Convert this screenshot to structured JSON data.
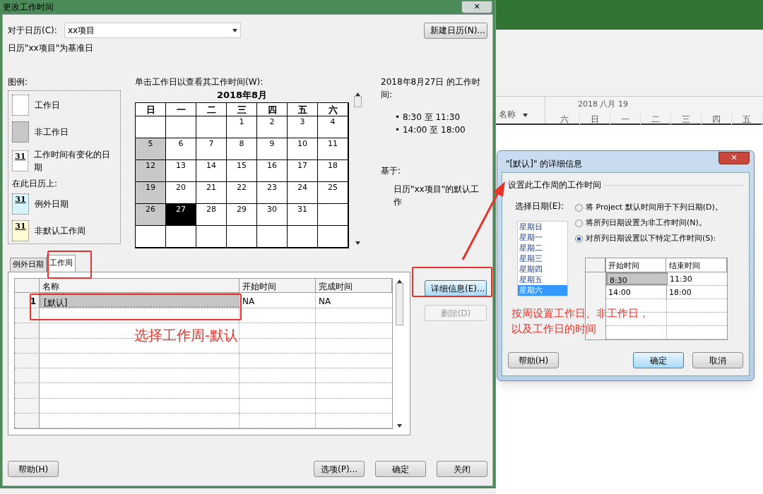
{
  "dialog": {
    "title": "更改工作时间",
    "close": "✕",
    "calendar_label": "对于日历(C):",
    "calendar_value": "xx项目",
    "new_calendar_button": "新建日历(N)...",
    "base_note": "日历\"xx项目\"为基准日",
    "legend": {
      "title": "图例:",
      "items": [
        {
          "kind": "working",
          "label": "工作日"
        },
        {
          "kind": "nonworking",
          "label": "非工作日"
        },
        {
          "kind": "changed",
          "label": "工作时间有变化的日期",
          "mark": "31"
        }
      ],
      "subtitle": "在此日历上:",
      "items2": [
        {
          "kind": "exception",
          "label": "例外日期",
          "mark": "31"
        },
        {
          "kind": "nondefault",
          "label": "非默认工作周",
          "mark": "31"
        }
      ]
    },
    "calendar": {
      "prompt": "单击工作日以查看其工作时间(W):",
      "month": "2018年8月",
      "weekdays": [
        "日",
        "一",
        "二",
        "三",
        "四",
        "五",
        "六"
      ],
      "weeks": [
        [
          {
            "kind": "empty"
          },
          {
            "kind": "empty"
          },
          {
            "kind": "empty"
          },
          {
            "kind": "day",
            "day": "1",
            "nonworking": false,
            "selected": false
          },
          {
            "kind": "day",
            "day": "2",
            "nonworking": false,
            "selected": false
          },
          {
            "kind": "day",
            "day": "3",
            "nonworking": false,
            "selected": false
          },
          {
            "kind": "day",
            "day": "4",
            "nonworking": false,
            "selected": false
          }
        ],
        [
          {
            "kind": "day",
            "day": "5",
            "nonworking": true,
            "selected": false
          },
          {
            "kind": "day",
            "day": "6",
            "nonworking": false,
            "selected": false
          },
          {
            "kind": "day",
            "day": "7",
            "nonworking": false,
            "selected": false
          },
          {
            "kind": "day",
            "day": "8",
            "nonworking": false,
            "selected": false
          },
          {
            "kind": "day",
            "day": "9",
            "nonworking": false,
            "selected": false
          },
          {
            "kind": "day",
            "day": "10",
            "nonworking": false,
            "selected": false
          },
          {
            "kind": "day",
            "day": "11",
            "nonworking": false,
            "selected": false
          }
        ],
        [
          {
            "kind": "day",
            "day": "12",
            "nonworking": true,
            "selected": false
          },
          {
            "kind": "day",
            "day": "13",
            "nonworking": false,
            "selected": false
          },
          {
            "kind": "day",
            "day": "14",
            "nonworking": false,
            "selected": false
          },
          {
            "kind": "day",
            "day": "15",
            "nonworking": false,
            "selected": false
          },
          {
            "kind": "day",
            "day": "16",
            "nonworking": false,
            "selected": false
          },
          {
            "kind": "day",
            "day": "17",
            "nonworking": false,
            "selected": false
          },
          {
            "kind": "day",
            "day": "18",
            "nonworking": false,
            "selected": false
          }
        ],
        [
          {
            "kind": "day",
            "day": "19",
            "nonworking": true,
            "selected": false
          },
          {
            "kind": "day",
            "day": "20",
            "nonworking": false,
            "selected": false
          },
          {
            "kind": "day",
            "day": "21",
            "nonworking": false,
            "selected": false
          },
          {
            "kind": "day",
            "day": "22",
            "nonworking": false,
            "selected": false
          },
          {
            "kind": "day",
            "day": "23",
            "nonworking": false,
            "selected": false
          },
          {
            "kind": "day",
            "day": "24",
            "nonworking": false,
            "selected": false
          },
          {
            "kind": "day",
            "day": "25",
            "nonworking": false,
            "selected": false
          }
        ],
        [
          {
            "kind": "day",
            "day": "26",
            "nonworking": true,
            "selected": false
          },
          {
            "kind": "day",
            "day": "27",
            "nonworking": false,
            "selected": true
          },
          {
            "kind": "day",
            "day": "28",
            "nonworking": false,
            "selected": false
          },
          {
            "kind": "day",
            "day": "29",
            "nonworking": false,
            "selected": false
          },
          {
            "kind": "day",
            "day": "30",
            "nonworking": false,
            "selected": false
          },
          {
            "kind": "day",
            "day": "31",
            "nonworking": false,
            "selected": false
          },
          {
            "kind": "empty"
          }
        ],
        [
          {
            "kind": "empty"
          },
          {
            "kind": "empty"
          },
          {
            "kind": "empty"
          },
          {
            "kind": "empty"
          },
          {
            "kind": "empty"
          },
          {
            "kind": "empty"
          },
          {
            "kind": "empty"
          }
        ]
      ]
    },
    "info": {
      "title": "2018年8月27日 的工作时间:",
      "times": [
        "• 8:30 至 11:30",
        "• 14:00 至 18:00"
      ],
      "based_on": "基于:",
      "based_text": "日历\"xx项目\"的默认工作"
    },
    "tabs": [
      {
        "label": "例外日期",
        "selected": false
      },
      {
        "label": "工作周",
        "selected": true
      }
    ],
    "table": {
      "columns": [
        "名称",
        "开始时间",
        "完成时间"
      ],
      "rows": [
        {
          "number": "1",
          "name": "[默认]",
          "start": "NA",
          "finish": "NA",
          "selected": true
        }
      ]
    },
    "side_buttons": [
      {
        "label": "详细信息(E)...",
        "disabled": false,
        "focused": true
      },
      {
        "label": "删除(D)",
        "disabled": true,
        "focused": false
      }
    ],
    "bottom_buttons": [
      {
        "label": "帮助(H)",
        "focused": false
      },
      {
        "label": "选项(P)...",
        "focused": false
      },
      {
        "label": "确定",
        "focused": false
      },
      {
        "label": "关闭",
        "focused": false
      }
    ]
  },
  "background_app": {
    "name_column": "名称",
    "timescale": "2018 八月 19",
    "days": [
      "六",
      "日",
      "一",
      "二",
      "三",
      "四",
      "五"
    ]
  },
  "details_dialog": {
    "title": "\"[默认]\" 的详细信息",
    "close": "✕",
    "group": "设置此工作周的工作时间",
    "select_label": "选择日期(E):",
    "days": [
      {
        "label": "星期日",
        "selected": false
      },
      {
        "label": "星期一",
        "selected": false
      },
      {
        "label": "星期二",
        "selected": false
      },
      {
        "label": "星期三",
        "selected": false
      },
      {
        "label": "星期四",
        "selected": false
      },
      {
        "label": "星期五",
        "selected": false
      },
      {
        "label": "星期六",
        "selected": true
      }
    ],
    "options": [
      {
        "label": "将 Project 默认时间用于下列日期(D)。",
        "selected": false
      },
      {
        "label": "将所列日期设置为非工作时间(N)。",
        "selected": false
      },
      {
        "label": "对所列日期设置以下特定工作时间(S):",
        "selected": true
      }
    ],
    "columns": [
      "开始时间",
      "结束时间"
    ],
    "rows": [
      {
        "start": "8:30",
        "end": "11:30",
        "selected": true
      },
      {
        "start": "14:00",
        "end": "18:00",
        "selected": false
      }
    ],
    "buttons": [
      {
        "label": "帮助(H)",
        "focused": false
      },
      {
        "label": "确定",
        "focused": true
      },
      {
        "label": "取消",
        "focused": false
      }
    ]
  },
  "annotations": [
    {
      "kind": "week",
      "text": "选择工作周-默认"
    },
    {
      "kind": "detail",
      "text": "按周设置工作日、非工作日，"
    },
    {
      "kind": "detail",
      "text": "以及工作日的时间"
    }
  ]
}
